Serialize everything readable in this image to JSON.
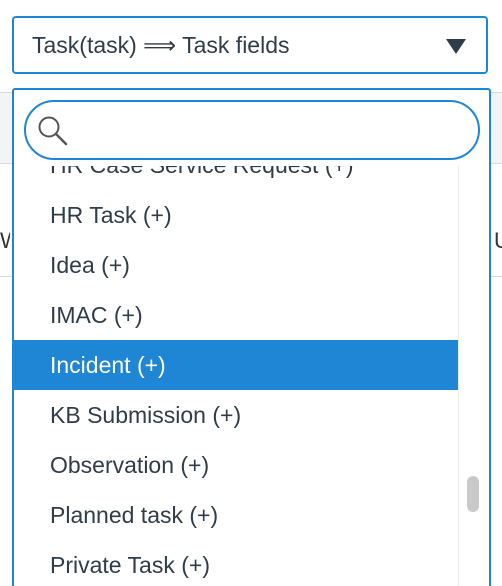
{
  "select": {
    "value": "Task(task) ⟹ Task fields",
    "caret_icon": "triangle-down-icon"
  },
  "search": {
    "placeholder": "",
    "value": "",
    "icon": "search-icon"
  },
  "options": [
    {
      "label": "HR Case Service Request (+)",
      "selected": false
    },
    {
      "label": "HR Task (+)",
      "selected": false
    },
    {
      "label": "Idea (+)",
      "selected": false
    },
    {
      "label": "IMAC (+)",
      "selected": false
    },
    {
      "label": "Incident (+)",
      "selected": true
    },
    {
      "label": "KB Submission (+)",
      "selected": false
    },
    {
      "label": "Observation (+)",
      "selected": false
    },
    {
      "label": "Planned task (+)",
      "selected": false
    },
    {
      "label": "Private Task (+)",
      "selected": false
    }
  ],
  "colors": {
    "accent": "#1f86d6",
    "text": "#2e3d49",
    "selected_text": "#ffffff"
  }
}
